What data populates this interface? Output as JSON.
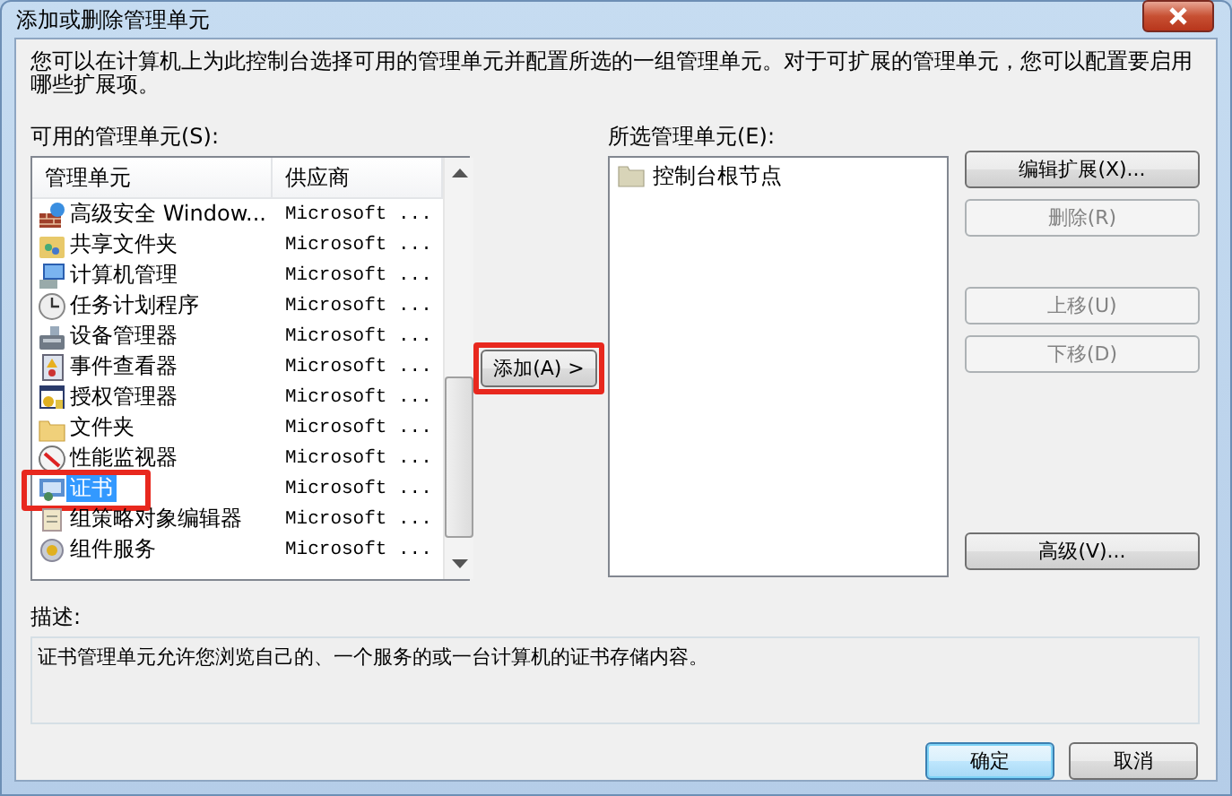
{
  "window": {
    "title": "添加或删除管理单元"
  },
  "intro": "您可以在计算机上为此控制台选择可用的管理单元并配置所选的一组管理单元。对于可扩展的管理单元，您可以配置要启用哪些扩展项。",
  "available": {
    "label": "可用的管理单元(S):",
    "columns": [
      "管理单元",
      "供应商"
    ],
    "rows": [
      {
        "name": "高级安全 Window...",
        "vendor": "Microsoft ...",
        "selected": false,
        "highlighted": false
      },
      {
        "name": "共享文件夹",
        "vendor": "Microsoft ...",
        "selected": false,
        "highlighted": false
      },
      {
        "name": "计算机管理",
        "vendor": "Microsoft ...",
        "selected": false,
        "highlighted": false
      },
      {
        "name": "任务计划程序",
        "vendor": "Microsoft ...",
        "selected": false,
        "highlighted": false
      },
      {
        "name": "设备管理器",
        "vendor": "Microsoft ...",
        "selected": false,
        "highlighted": false
      },
      {
        "name": "事件查看器",
        "vendor": "Microsoft ...",
        "selected": false,
        "highlighted": false
      },
      {
        "name": "授权管理器",
        "vendor": "Microsoft ...",
        "selected": false,
        "highlighted": false
      },
      {
        "name": "文件夹",
        "vendor": "Microsoft ...",
        "selected": false,
        "highlighted": false
      },
      {
        "name": "性能监视器",
        "vendor": "Microsoft ...",
        "selected": false,
        "highlighted": false
      },
      {
        "name": "证书",
        "vendor": "Microsoft ...",
        "selected": true,
        "highlighted": true
      },
      {
        "name": "组策略对象编辑器",
        "vendor": "Microsoft ...",
        "selected": false,
        "highlighted": false
      },
      {
        "name": "组件服务",
        "vendor": "Microsoft ...",
        "selected": false,
        "highlighted": false
      }
    ]
  },
  "add_button": {
    "label": "添加(A) >",
    "highlighted": true
  },
  "selected_snapins": {
    "label": "所选管理单元(E):",
    "items": [
      "控制台根节点"
    ]
  },
  "side_buttons": [
    {
      "label": "编辑扩展(X)...",
      "disabled": false
    },
    {
      "label": "删除(R)",
      "disabled": true
    },
    {
      "label": "上移(U)",
      "disabled": true
    },
    {
      "label": "下移(D)",
      "disabled": true
    },
    {
      "label": "高级(V)...",
      "disabled": false
    }
  ],
  "description": {
    "label": "描述:",
    "text": "证书管理单元允许您浏览自己的、一个服务的或一台计算机的证书存储内容。"
  },
  "footer_buttons": [
    {
      "label": "确定",
      "default": true
    },
    {
      "label": "取消",
      "default": false
    }
  ]
}
